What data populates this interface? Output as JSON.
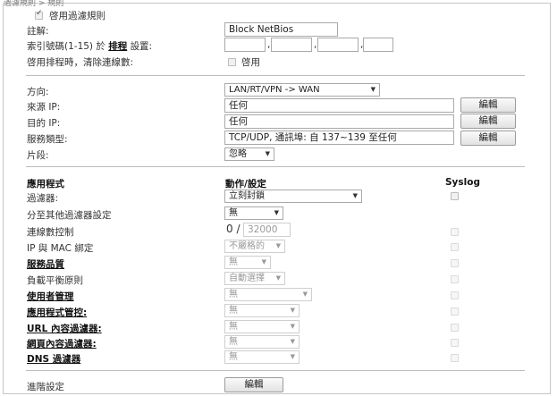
{
  "breadcrumb": "過濾規則 > 規則",
  "enable_rule": {
    "label": "啓用過濾規則",
    "checked": true
  },
  "comment": {
    "label": "註解:",
    "value": "Block NetBios"
  },
  "schedule": {
    "label_prefix": "索引號碼(1-15) 於",
    "label_link": "排程",
    "label_suffix": "設置:",
    "separators": [
      ",",
      ",",
      ","
    ]
  },
  "clear_sessions": {
    "label": "啓用排程時，清除連線數:",
    "checkbox_label": "啓用"
  },
  "direction": {
    "label": "方向:",
    "value": "LAN/RT/VPN -> WAN"
  },
  "source_ip": {
    "label": "來源 IP:",
    "value": "任何",
    "button": "編輯"
  },
  "dest_ip": {
    "label": "目的 IP:",
    "value": "任何",
    "button": "編輯"
  },
  "service_type": {
    "label": "服務類型:",
    "value": "TCP/UDP, 通訊埠: 自 137~139 至任何",
    "button": "編輯"
  },
  "fragments": {
    "label": "片段:",
    "value": "忽略"
  },
  "app_header": {
    "app": "應用程式",
    "action": "動作/設定",
    "syslog": "Syslog"
  },
  "filter": {
    "label": "過濾器:",
    "value": "立刻封鎖"
  },
  "branch": {
    "label": "分至其他過濾器設定",
    "value": "無"
  },
  "session_ctrl": {
    "label": "連線數控制",
    "current": "0",
    "slash": "/",
    "limit": "32000"
  },
  "ip_mac": {
    "label": "IP 與 MAC 綁定",
    "value": "不嚴格的"
  },
  "qos": {
    "label": "服務品質",
    "value": "無"
  },
  "load_balance": {
    "label": "負載平衡原則",
    "value": "自動選擇"
  },
  "user_mgmt": {
    "label": "使用者管理",
    "value": "無"
  },
  "app_control": {
    "label": "應用程式管控:",
    "value": "無"
  },
  "url_filter": {
    "label": "URL 內容過濾器:",
    "value": "無"
  },
  "web_filter": {
    "label": "網頁內容過濾器:",
    "value": "無"
  },
  "dns_filter": {
    "label": "DNS 過濾器",
    "value": "無"
  },
  "advanced": {
    "label": "進階設定",
    "button": "編輯"
  },
  "icons": {
    "caret": "caret-down-icon",
    "check": "check-icon"
  }
}
